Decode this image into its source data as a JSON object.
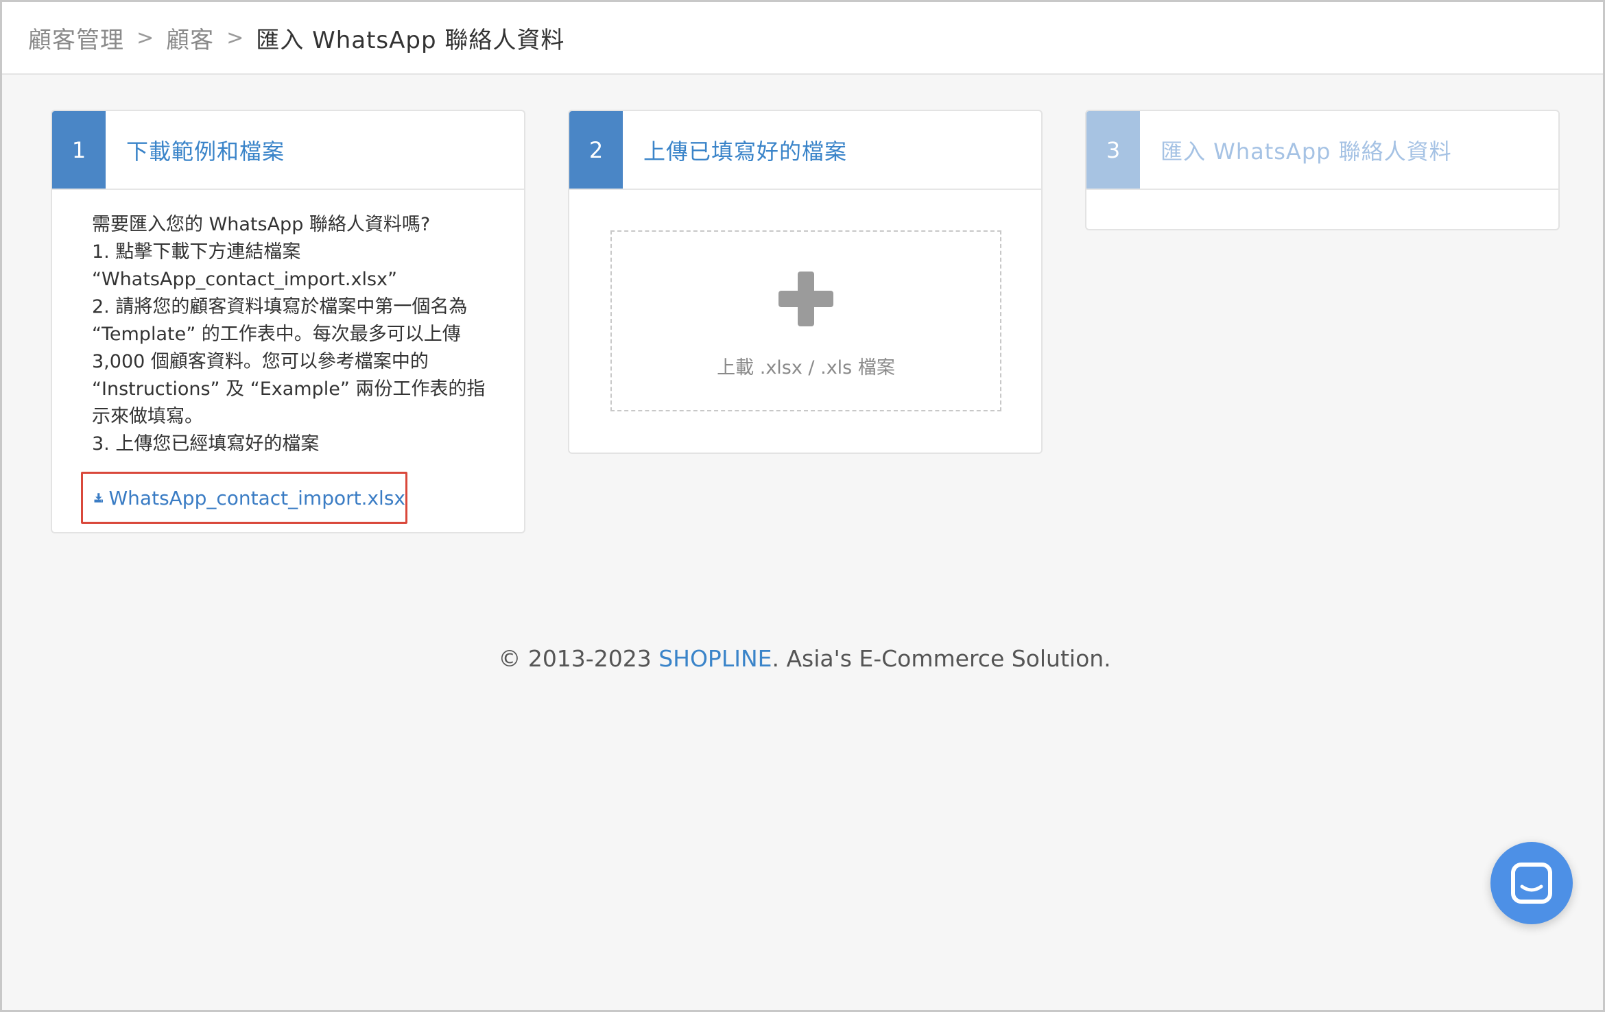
{
  "breadcrumb": {
    "items": [
      "顧客管理",
      "顧客",
      "匯入 WhatsApp 聯絡人資料"
    ],
    "separator": ">"
  },
  "steps": [
    {
      "number": "1",
      "title": "下載範例和檔案"
    },
    {
      "number": "2",
      "title": "上傳已填寫好的檔案"
    },
    {
      "number": "3",
      "title": "匯入 WhatsApp 聯絡人資料"
    }
  ],
  "instructions": [
    "需要匯入您的 WhatsApp 聯絡人資料嗎?",
    "1. 點擊下載下方連結檔案",
    "“WhatsApp_contact_import.xlsx”",
    "2. 請將您的顧客資料填寫於檔案中第一個名為",
    "“Template” 的工作表中。每次最多可以上傳",
    "3,000 個顧客資料。您可以參考檔案中的",
    "“Instructions” 及 “Example” 兩份工作表的指",
    "示來做填寫。",
    "3. 上傳您已經填寫好的檔案"
  ],
  "download": {
    "label": "WhatsApp_contact_import.xlsx",
    "icon": "download-icon"
  },
  "upload": {
    "label": "上載 .xlsx / .xls 檔案",
    "icon": "plus-icon"
  },
  "footer": {
    "prefix": "© 2013-2023 ",
    "brand": "SHOPLINE",
    "suffix": ". Asia's E-Commerce Solution."
  },
  "chat": {
    "icon": "chat-icon"
  },
  "colors": {
    "accent": "#4a86c6",
    "accent_disabled": "#a7c3e2",
    "link": "#3a7cc4",
    "highlight_border": "#d9483b",
    "chat_button": "#4d90e6"
  }
}
